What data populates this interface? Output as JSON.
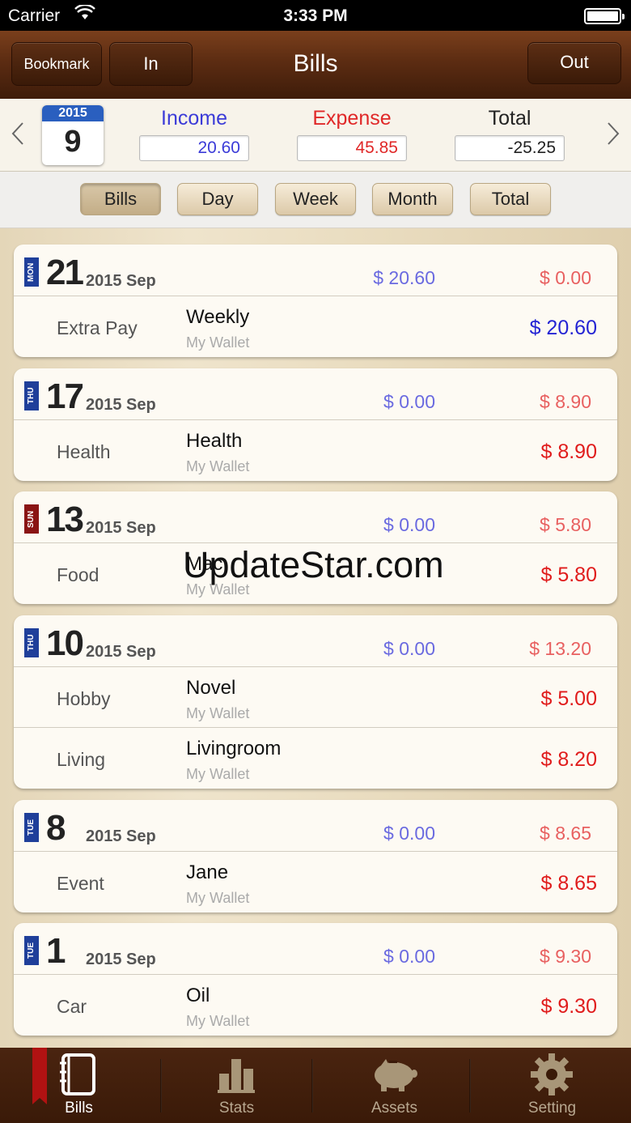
{
  "status_bar": {
    "carrier": "Carrier",
    "time": "3:33 PM"
  },
  "nav": {
    "title": "Bills",
    "bookmark": "Bookmark",
    "in": "In",
    "out": "Out"
  },
  "summary": {
    "year": "2015",
    "month": "9",
    "income_label": "Income",
    "income_value": "20.60",
    "expense_label": "Expense",
    "expense_value": "45.85",
    "total_label": "Total",
    "total_value": "-25.25",
    "colors": {
      "income": "#3b3bd8",
      "expense": "#e02828"
    }
  },
  "segments": [
    "Bills",
    "Day",
    "Week",
    "Month",
    "Total"
  ],
  "days": [
    {
      "dow": "MON",
      "day": "21",
      "ym": "2015 Sep",
      "in": "$ 20.60",
      "out": "$ 0.00",
      "entries": [
        {
          "cat": "Extra Pay",
          "name": "Weekly",
          "wallet": "My Wallet",
          "amt": "$ 20.60",
          "type": "in"
        }
      ]
    },
    {
      "dow": "THU",
      "day": "17",
      "ym": "2015 Sep",
      "in": "$ 0.00",
      "out": "$ 8.90",
      "entries": [
        {
          "cat": "Health",
          "name": "Health",
          "wallet": "My Wallet",
          "amt": "$ 8.90",
          "type": "out"
        }
      ]
    },
    {
      "dow": "SUN",
      "day": "13",
      "ym": "2015 Sep",
      "in": "$ 0.00",
      "out": "$ 5.80",
      "entries": [
        {
          "cat": "Food",
          "name": "Mac",
          "wallet": "My Wallet",
          "amt": "$ 5.80",
          "type": "out"
        }
      ]
    },
    {
      "dow": "THU",
      "day": "10",
      "ym": "2015 Sep",
      "in": "$ 0.00",
      "out": "$ 13.20",
      "entries": [
        {
          "cat": "Hobby",
          "name": "Novel",
          "wallet": "My Wallet",
          "amt": "$ 5.00",
          "type": "out"
        },
        {
          "cat": "Living",
          "name": "Livingroom",
          "wallet": "My Wallet",
          "amt": "$ 8.20",
          "type": "out"
        }
      ]
    },
    {
      "dow": "TUE",
      "day": "8",
      "ym": "2015 Sep",
      "in": "$ 0.00",
      "out": "$ 8.65",
      "entries": [
        {
          "cat": "Event",
          "name": "Jane",
          "wallet": "My Wallet",
          "amt": "$ 8.65",
          "type": "out"
        }
      ]
    },
    {
      "dow": "TUE",
      "day": "1",
      "ym": "2015 Sep",
      "in": "$ 0.00",
      "out": "$ 9.30",
      "entries": [
        {
          "cat": "Car",
          "name": "Oil",
          "wallet": "My Wallet",
          "amt": "$ 9.30",
          "type": "out"
        }
      ]
    }
  ],
  "watermark": "UpdateStar.com",
  "tabs": [
    {
      "label": "Bills",
      "icon": "notebook-icon"
    },
    {
      "label": "Stats",
      "icon": "bar-chart-icon"
    },
    {
      "label": "Assets",
      "icon": "piggy-bank-icon"
    },
    {
      "label": "Setting",
      "icon": "gear-icon"
    }
  ]
}
